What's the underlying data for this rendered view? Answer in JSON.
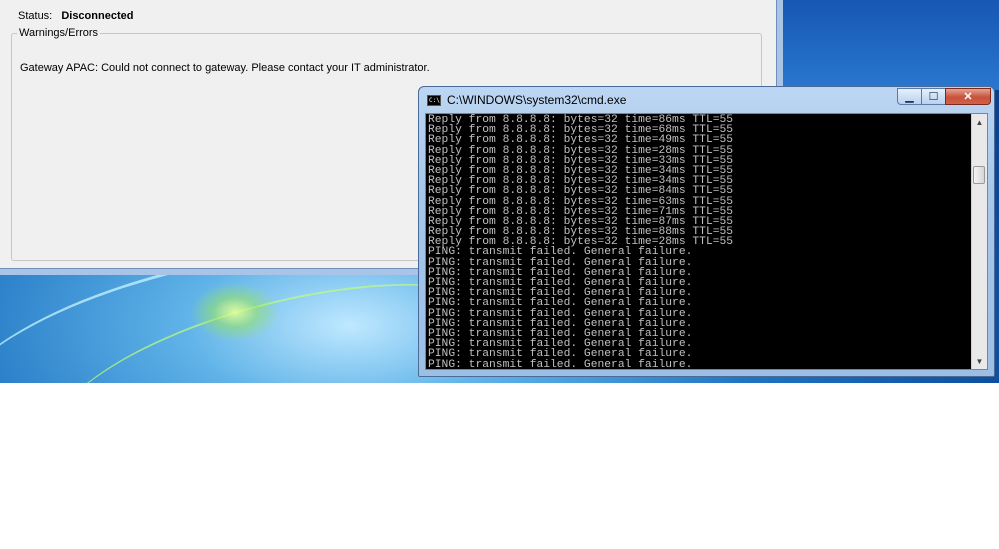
{
  "vpn_dialog": {
    "status_label": "Status:",
    "status_value": "Disconnected",
    "warnings_group_title": "Warnings/Errors",
    "warning_message": "Gateway APAC: Could not connect to gateway. Please contact your IT administrator."
  },
  "cmd_window": {
    "title": "C:\\WINDOWS\\system32\\cmd.exe",
    "icon_text": "C:\\",
    "minimize_glyph": "▁",
    "maximize_glyph": "☐",
    "close_glyph": "✕",
    "scroll_up_glyph": "▲",
    "scroll_down_glyph": "▼",
    "output_lines": [
      "Reply from 8.8.8.8: bytes=32 time=86ms TTL=55",
      "Reply from 8.8.8.8: bytes=32 time=68ms TTL=55",
      "Reply from 8.8.8.8: bytes=32 time=49ms TTL=55",
      "Reply from 8.8.8.8: bytes=32 time=28ms TTL=55",
      "Reply from 8.8.8.8: bytes=32 time=33ms TTL=55",
      "Reply from 8.8.8.8: bytes=32 time=34ms TTL=55",
      "Reply from 8.8.8.8: bytes=32 time=34ms TTL=55",
      "Reply from 8.8.8.8: bytes=32 time=84ms TTL=55",
      "Reply from 8.8.8.8: bytes=32 time=63ms TTL=55",
      "Reply from 8.8.8.8: bytes=32 time=71ms TTL=55",
      "Reply from 8.8.8.8: bytes=32 time=87ms TTL=55",
      "Reply from 8.8.8.8: bytes=32 time=88ms TTL=55",
      "Reply from 8.8.8.8: bytes=32 time=28ms TTL=55",
      "PING: transmit failed. General failure.",
      "PING: transmit failed. General failure.",
      "PING: transmit failed. General failure.",
      "PING: transmit failed. General failure.",
      "PING: transmit failed. General failure.",
      "PING: transmit failed. General failure.",
      "PING: transmit failed. General failure.",
      "PING: transmit failed. General failure.",
      "PING: transmit failed. General failure.",
      "PING: transmit failed. General failure.",
      "PING: transmit failed. General failure.",
      "PING: transmit failed. General failure."
    ]
  },
  "colors": {
    "console_background": "#000000",
    "console_text": "#c0c0c0",
    "close_button": "#c7513a",
    "dialog_background": "#f0f0f0"
  }
}
